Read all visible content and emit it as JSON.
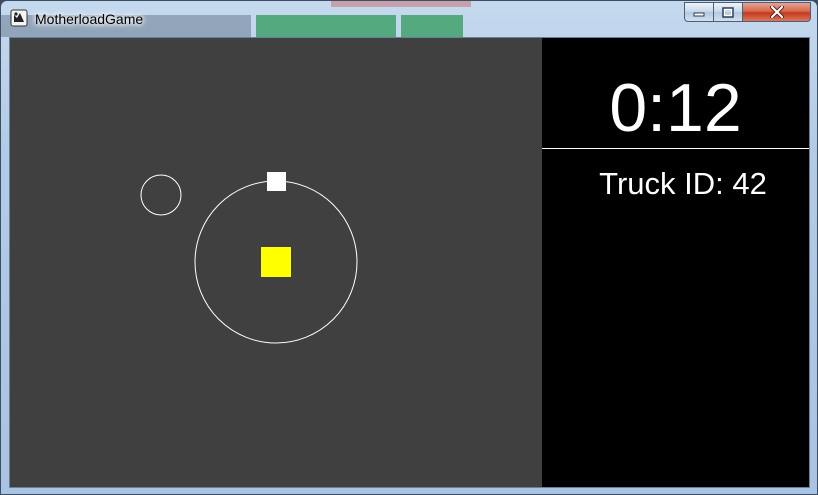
{
  "window": {
    "title": "MotherloadGame",
    "controls": {
      "minimize": "minimize-icon",
      "maximize": "maximize-icon",
      "close": "close-icon"
    }
  },
  "hud": {
    "timer": "0:12",
    "truck_id_label": "Truck ID: 42"
  },
  "colors": {
    "game_background": "#404040",
    "hud_background": "#000000",
    "truck": "#ffff00",
    "marker": "#ffffff",
    "ring": "#ffffff"
  }
}
